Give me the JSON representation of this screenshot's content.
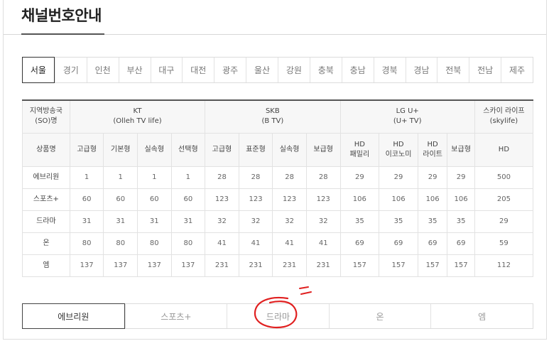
{
  "title": "채널번호안내",
  "regions": [
    "서울",
    "경기",
    "인천",
    "부산",
    "대구",
    "대전",
    "광주",
    "울산",
    "강원",
    "충북",
    "충남",
    "경북",
    "경남",
    "전북",
    "전남",
    "제주"
  ],
  "active_region": "서울",
  "table": {
    "corner_label_1": "지역방송국",
    "corner_label_2": "(SO)명",
    "providers": [
      {
        "name": "KT",
        "sub": "(Olleh TV life)"
      },
      {
        "name": "SKB",
        "sub": "(B TV)"
      },
      {
        "name": "LG U+",
        "sub": "(U+ TV)"
      },
      {
        "name": "스카이 라이프",
        "sub": "(skylife)"
      }
    ],
    "product_label": "상품명",
    "products": [
      [
        "고급형"
      ],
      [
        "기본형"
      ],
      [
        "실속형"
      ],
      [
        "선택형"
      ],
      [
        "고급형"
      ],
      [
        "표준형"
      ],
      [
        "실속형"
      ],
      [
        "보급형"
      ],
      [
        "HD",
        "패밀리"
      ],
      [
        "HD",
        "이코노미"
      ],
      [
        "HD",
        "라이트"
      ],
      [
        "보급형"
      ],
      [
        "HD"
      ]
    ],
    "rows": [
      {
        "channel": "에브리원",
        "values": [
          "1",
          "1",
          "1",
          "1",
          "28",
          "28",
          "28",
          "28",
          "29",
          "29",
          "29",
          "29",
          "500"
        ]
      },
      {
        "channel": "스포츠+",
        "values": [
          "60",
          "60",
          "60",
          "60",
          "123",
          "123",
          "123",
          "123",
          "106",
          "106",
          "106",
          "106",
          "205"
        ]
      },
      {
        "channel": "드라마",
        "values": [
          "31",
          "31",
          "31",
          "31",
          "32",
          "32",
          "32",
          "32",
          "35",
          "35",
          "35",
          "35",
          "29"
        ]
      },
      {
        "channel": "온",
        "values": [
          "80",
          "80",
          "80",
          "80",
          "41",
          "41",
          "41",
          "41",
          "69",
          "69",
          "69",
          "69",
          "59"
        ]
      },
      {
        "channel": "엠",
        "values": [
          "137",
          "137",
          "137",
          "137",
          "231",
          "231",
          "231",
          "231",
          "157",
          "157",
          "157",
          "157",
          "112"
        ]
      }
    ]
  },
  "channel_tabs": [
    "에브리원",
    "스포츠+",
    "드라마",
    "온",
    "엠"
  ],
  "active_channel_tab": "에브리원",
  "colors": {
    "accent_line": "#555555",
    "annotation_red": "#e02020"
  }
}
